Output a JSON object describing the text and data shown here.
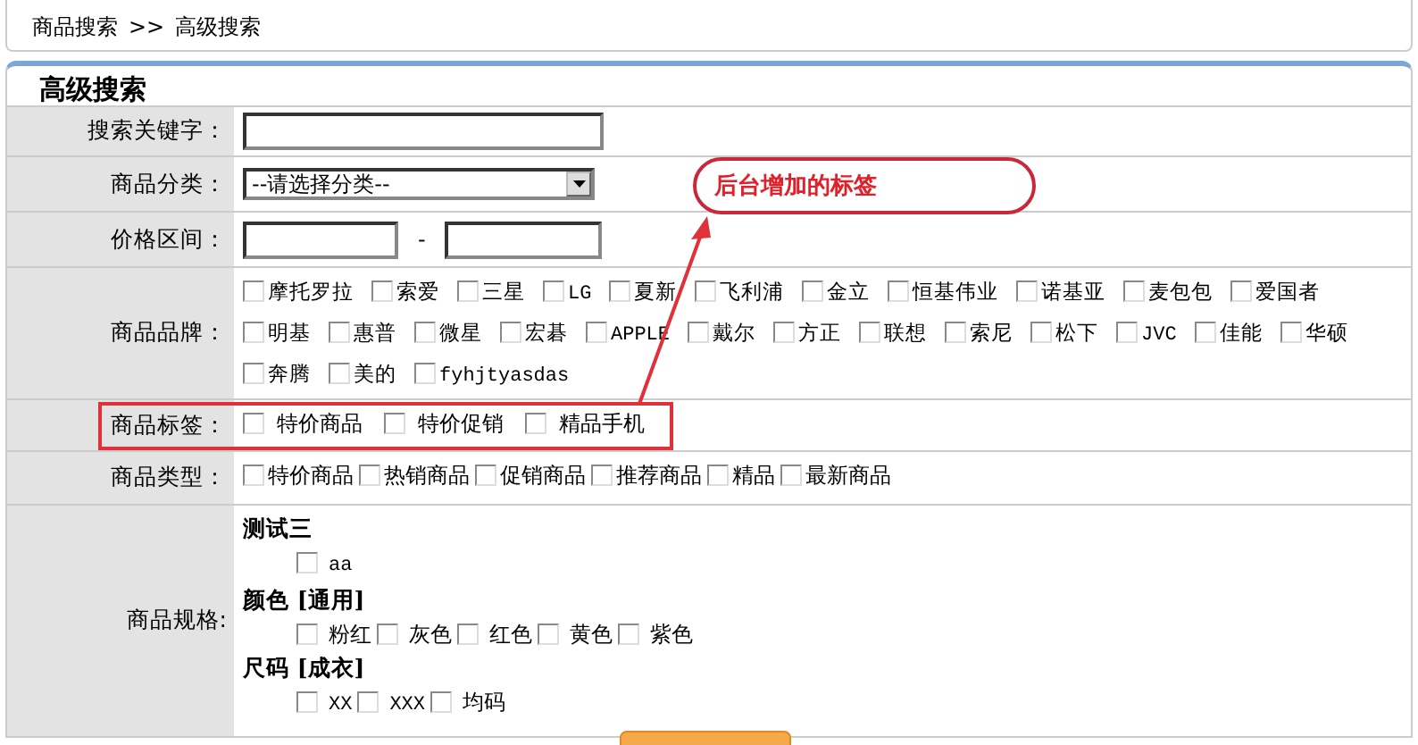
{
  "breadcrumb": [
    "商品搜索",
    ">>",
    "高级搜索"
  ],
  "panel": {
    "title": "高级搜索"
  },
  "fields": [
    {
      "kind": "text",
      "label": "搜索关键字："
    },
    {
      "kind": "select",
      "label": "商品分类：",
      "value": "--请选择分类--"
    },
    {
      "kind": "range",
      "label": "价格区间：",
      "separator": "-"
    },
    {
      "kind": "checks",
      "label": "商品品牌：",
      "options": [
        {
          "text": "摩托罗拉",
          "checked": false
        },
        {
          "text": "索爱",
          "checked": false
        },
        {
          "text": "三星",
          "checked": false
        },
        {
          "text": "LG",
          "checked": false
        },
        {
          "text": "夏新",
          "checked": false
        },
        {
          "text": "飞利浦",
          "checked": false
        },
        {
          "text": "金立",
          "checked": false
        },
        {
          "text": "恒基伟业",
          "checked": false
        },
        {
          "text": "诺基亚",
          "checked": false
        },
        {
          "text": "麦包包",
          "checked": false
        },
        {
          "text": "爱国者",
          "checked": false
        },
        {
          "text": "明基",
          "checked": false
        },
        {
          "text": "惠普",
          "checked": false
        },
        {
          "text": "微星",
          "checked": false
        },
        {
          "text": "宏碁",
          "checked": false
        },
        {
          "text": "APPLE",
          "checked": false
        },
        {
          "text": "戴尔",
          "checked": false
        },
        {
          "text": "方正",
          "checked": false
        },
        {
          "text": "联想",
          "checked": false
        },
        {
          "text": "索尼",
          "checked": false
        },
        {
          "text": "松下",
          "checked": false
        },
        {
          "text": "JVC",
          "checked": false
        },
        {
          "text": "佳能",
          "checked": false
        },
        {
          "text": "华硕",
          "checked": false
        },
        {
          "text": "奔腾",
          "checked": false
        },
        {
          "text": "美的",
          "checked": false
        },
        {
          "text": "fyhjtyasdas",
          "checked": false
        }
      ]
    },
    {
      "kind": "tags",
      "label": "商品标签：",
      "highlighted": true,
      "options": [
        {
          "text": "特价商品",
          "checked": false
        },
        {
          "text": "特价促销",
          "checked": false
        },
        {
          "text": "精品手机",
          "checked": false
        }
      ]
    },
    {
      "kind": "types",
      "label": "商品类型：",
      "options": [
        {
          "text": "特价商品",
          "checked": false
        },
        {
          "text": "热销商品",
          "checked": false
        },
        {
          "text": "促销商品",
          "checked": false
        },
        {
          "text": "推荐商品",
          "checked": false
        },
        {
          "text": "精品",
          "checked": false
        },
        {
          "text": "最新商品",
          "checked": false
        }
      ]
    },
    {
      "kind": "spec",
      "label": "商品规格:",
      "groups": [
        {
          "title": "测试三",
          "options": [
            {
              "text": "aa",
              "checked": false
            }
          ]
        },
        {
          "title": "颜色 [通用]",
          "options": [
            {
              "text": "粉红",
              "checked": false
            },
            {
              "text": "灰色",
              "checked": false
            },
            {
              "text": "红色",
              "checked": false
            },
            {
              "text": "黄色",
              "checked": false
            },
            {
              "text": "紫色",
              "checked": false
            }
          ]
        },
        {
          "title": "尺码 [成衣]",
          "options": [
            {
              "text": "XX",
              "checked": false
            },
            {
              "text": "XXX",
              "checked": false
            },
            {
              "text": "均码",
              "checked": false
            }
          ]
        }
      ]
    }
  ],
  "annotation": {
    "text": "后台增加的标签"
  }
}
